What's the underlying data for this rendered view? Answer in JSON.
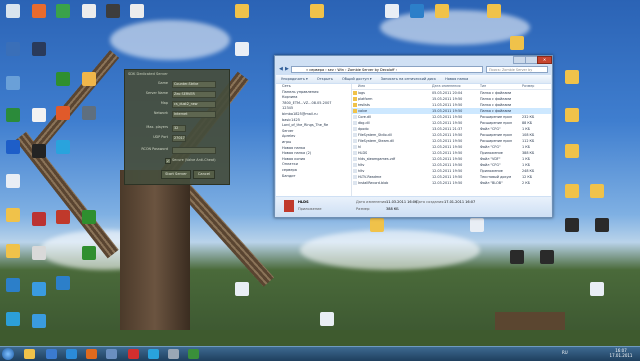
{
  "server_dialog": {
    "title": "SDK Dedicated Server",
    "fields": [
      {
        "label": "Game",
        "value": "Counter-Strike"
      },
      {
        "label": "Server Name",
        "value": "Zeo SERVER"
      },
      {
        "label": "Map",
        "value": "cs_dust2_new"
      },
      {
        "label": "Network",
        "value": "Internet"
      },
      {
        "label": "Max. players",
        "value": "32"
      },
      {
        "label": "UDP Port",
        "value": "27017"
      },
      {
        "label": "RCON Password",
        "value": ""
      }
    ],
    "secure_label": "Secure (Valve Anti-Cheat)",
    "start_label": "Start Server",
    "cancel_label": "Cancel"
  },
  "explorer": {
    "breadcrumb": "« сервера › sev › Win › Zombie Server by Decoloff ›",
    "search_placeholder": "Поиск: Zombie Server by Decoloff",
    "toolbar": [
      "Упорядочить ▾",
      "Открыть",
      "Общий доступ ▾",
      "Записать на оптический диск",
      "Новая папка"
    ],
    "nav": [
      "Сеть",
      "Панель управления",
      "Корзина",
      "7800_ETM...VZ...08.05.2007",
      "12345",
      "bimbo1825@mail.ru",
      "basic1425",
      "Lord_of_the_Rings_The_Re",
      "Server",
      "Aprelev",
      "игры",
      "Новая папка",
      "Новая папка (2)",
      "Новая копия",
      "Оплатки",
      "сервера",
      "Бандит"
    ],
    "columns": [
      "Имя",
      "Дата изменения",
      "Тип",
      "Размер"
    ],
    "files": [
      {
        "name": "logs",
        "date": "05.03.2011 20:04",
        "type": "Папка с файлами",
        "size": ""
      },
      {
        "name": "platform",
        "date": "15.03.2011 19:50",
        "type": "Папка с файлами",
        "size": ""
      },
      {
        "name": "reslists",
        "date": "11.03.2011 19:50",
        "type": "Папка с файлами",
        "size": ""
      },
      {
        "name": "valve",
        "date": "15.03.2011 19:50",
        "type": "Папка с файлами",
        "size": ""
      },
      {
        "name": "Core.dll",
        "date": "12.03.2011 19:50",
        "type": "Расширение прил",
        "size": "232 КБ"
      },
      {
        "name": "dbg.dll",
        "date": "12.03.2011 19:50",
        "type": "Расширение прил",
        "size": "88 КБ"
      },
      {
        "name": "dpodo",
        "date": "13.03.2011 21:37",
        "type": "Файл \"CFG\"",
        "size": "1 КБ"
      },
      {
        "name": "FileSystem_Stdio.dll",
        "date": "12.03.2011 19:50",
        "type": "Расширение прил",
        "size": "108 КБ"
      },
      {
        "name": "FileSystem_Steam.dll",
        "date": "12.03.2011 19:50",
        "type": "Расширение прил",
        "size": "112 КБ"
      },
      {
        "name": "hl",
        "date": "12.03.2011 19:50",
        "type": "Файл \"CFG\"",
        "size": "1 КБ"
      },
      {
        "name": "HLDS",
        "date": "12.03.2011 19:50",
        "type": "Приложение",
        "size": "388 КБ"
      },
      {
        "name": "hlds_steamgames.vdf",
        "date": "12.03.2011 19:50",
        "type": "Файл \"VDF\"",
        "size": "1 КБ"
      },
      {
        "name": "hltv",
        "date": "12.03.2011 19:50",
        "type": "Файл \"CFG\"",
        "size": "1 КБ"
      },
      {
        "name": "hltv",
        "date": "12.03.2011 19:50",
        "type": "Приложение",
        "size": "248 КБ"
      },
      {
        "name": "HLTV-Readme",
        "date": "12.03.2011 19:50",
        "type": "Текстовый докум",
        "size": "12 КБ"
      },
      {
        "name": "InstallRecord.blob",
        "date": "12.03.2011 19:50",
        "type": "Файл \"BLOB\"",
        "size": "2 КБ"
      }
    ],
    "status": {
      "name": "HLDS",
      "type": "Приложение",
      "modified_label": "Дата изменения:",
      "modified": "11.03.2011 16:06",
      "created_label": "Дата создания:",
      "created": "17.01.2011 16:07",
      "size_label": "Размер:",
      "size": "388 КБ"
    }
  },
  "taskbar": {
    "lang": "RU",
    "time": "16:07",
    "date": "17.01.2011"
  }
}
